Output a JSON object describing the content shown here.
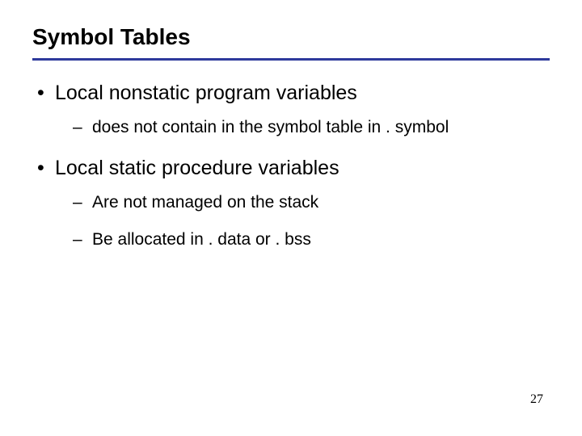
{
  "slide": {
    "title": "Symbol Tables",
    "bullets": [
      {
        "text": "Local nonstatic program variables",
        "sub": [
          "does not contain in the symbol table in . symbol"
        ]
      },
      {
        "text": "Local static procedure variables",
        "sub": [
          "Are not managed on the stack",
          "Be allocated in . data or . bss"
        ]
      }
    ],
    "page_number": "27"
  }
}
